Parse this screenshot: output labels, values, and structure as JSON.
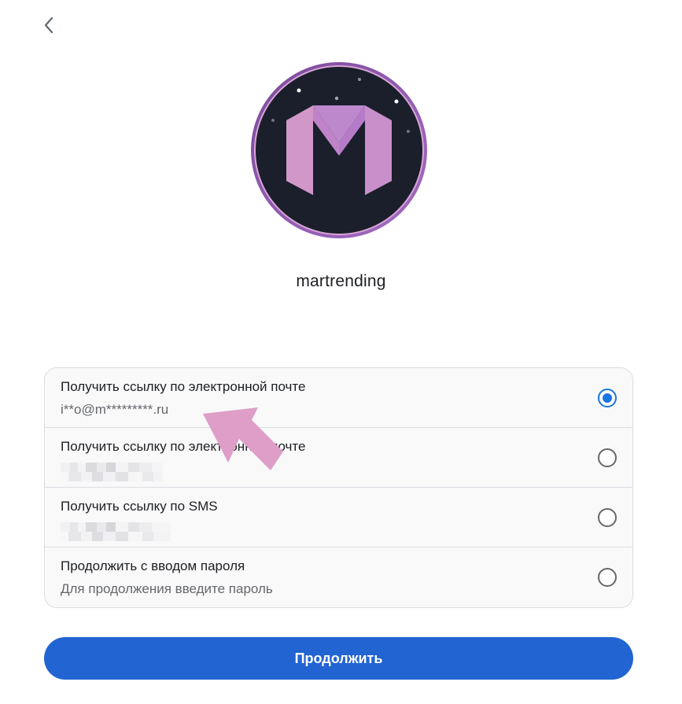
{
  "profile": {
    "username": "martrending"
  },
  "options": [
    {
      "title": "Получить ссылку по электронной почте",
      "subtitle": "i**o@m*********.ru",
      "selected": true
    },
    {
      "title": "Получить ссылку по электронной почте",
      "subtitle": "",
      "selected": false
    },
    {
      "title": "Получить ссылку по SMS",
      "subtitle": "",
      "selected": false
    },
    {
      "title": "Продолжить с вводом пароля",
      "subtitle": "Для продолжения введите пароль",
      "selected": false
    }
  ],
  "actions": {
    "continue_label": "Продолжить"
  },
  "icons": {
    "back": "chevron-left-icon",
    "logo": "brand-m-logo"
  },
  "colors": {
    "accent": "#2264d1",
    "radio_selected": "#1b74e4",
    "annotation_arrow": "#de9ec8"
  }
}
